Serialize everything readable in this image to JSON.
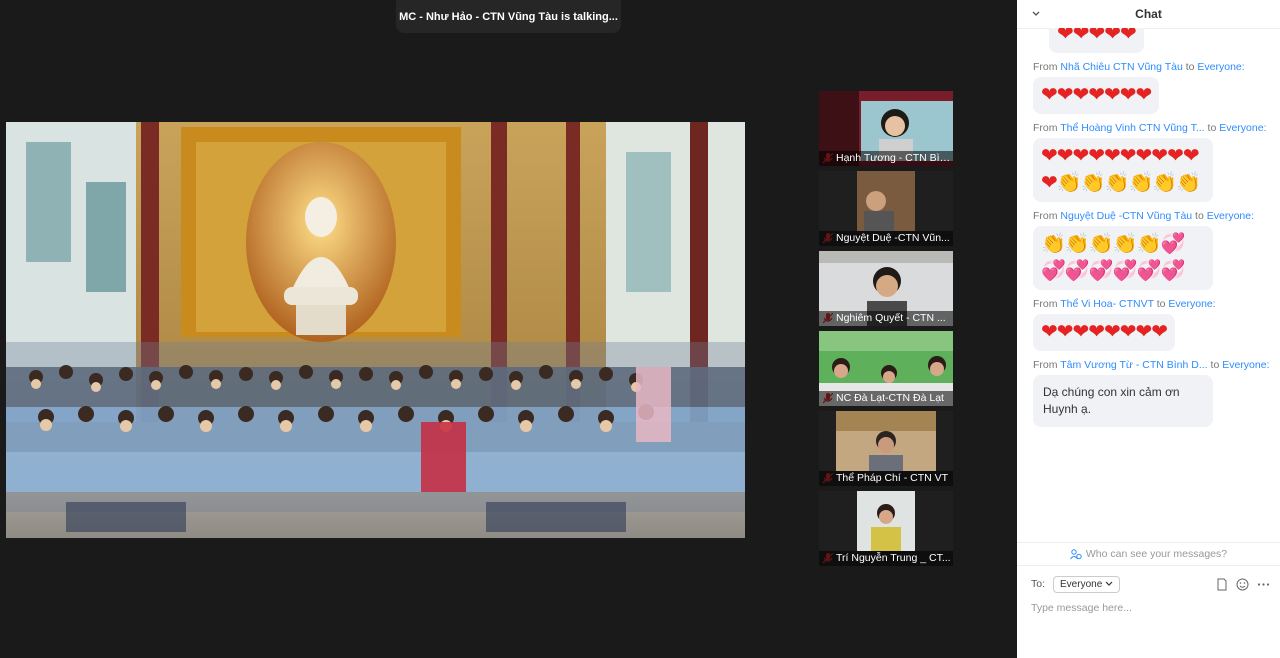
{
  "talking_banner": "MC - Như Hảo - CTN Vũng Tàu is talking...",
  "participants": [
    {
      "name": "Hạnh Tương - CTN Bình..."
    },
    {
      "name": "Nguyệt Duệ -CTN Vũn..."
    },
    {
      "name": "Nghiêm Quyết - CTN ..."
    },
    {
      "name": "NC Đà Lạt-CTN Đà Lạt"
    },
    {
      "name": "Thể Pháp Chí - CTN VT"
    },
    {
      "name": "Trí Nguyễn Trung _ CT..."
    }
  ],
  "chat": {
    "title": "Chat",
    "partial_top": "❤❤❤❤❤",
    "messages": [
      {
        "from": "Nhã Chiêu CTN Vũng Tàu",
        "to": "Everyone:",
        "content": "❤❤❤❤❤❤❤"
      },
      {
        "from": "Thể Hoàng Vinh CTN Vũng T...",
        "to": "Everyone:",
        "content": "❤❤❤❤❤❤❤❤❤❤❤👏👏👏👏👏👏"
      },
      {
        "from": "Nguyệt Duệ -CTN Vũng Tàu",
        "to": "Everyone:",
        "content": "👏👏👏👏👏💞💞💞💞💞💞💞"
      },
      {
        "from": "Thể Vi Hoa- CTNVT",
        "to": "Everyone:",
        "content": "❤❤❤❤❤❤❤❤"
      },
      {
        "from": "Tâm Vương Từ - CTN Bình D...",
        "to": "Everyone:",
        "content": "Dạ chúng con xin cảm ơn Huynh ạ."
      }
    ],
    "from_label": "From",
    "to_label": "to",
    "who_can_see": "Who can see your messages?",
    "to_prefix": "To:",
    "recipient": "Everyone",
    "input_placeholder": "Type message here..."
  },
  "colors": {
    "accent": "#2d8cff",
    "heart": "#e52323"
  }
}
